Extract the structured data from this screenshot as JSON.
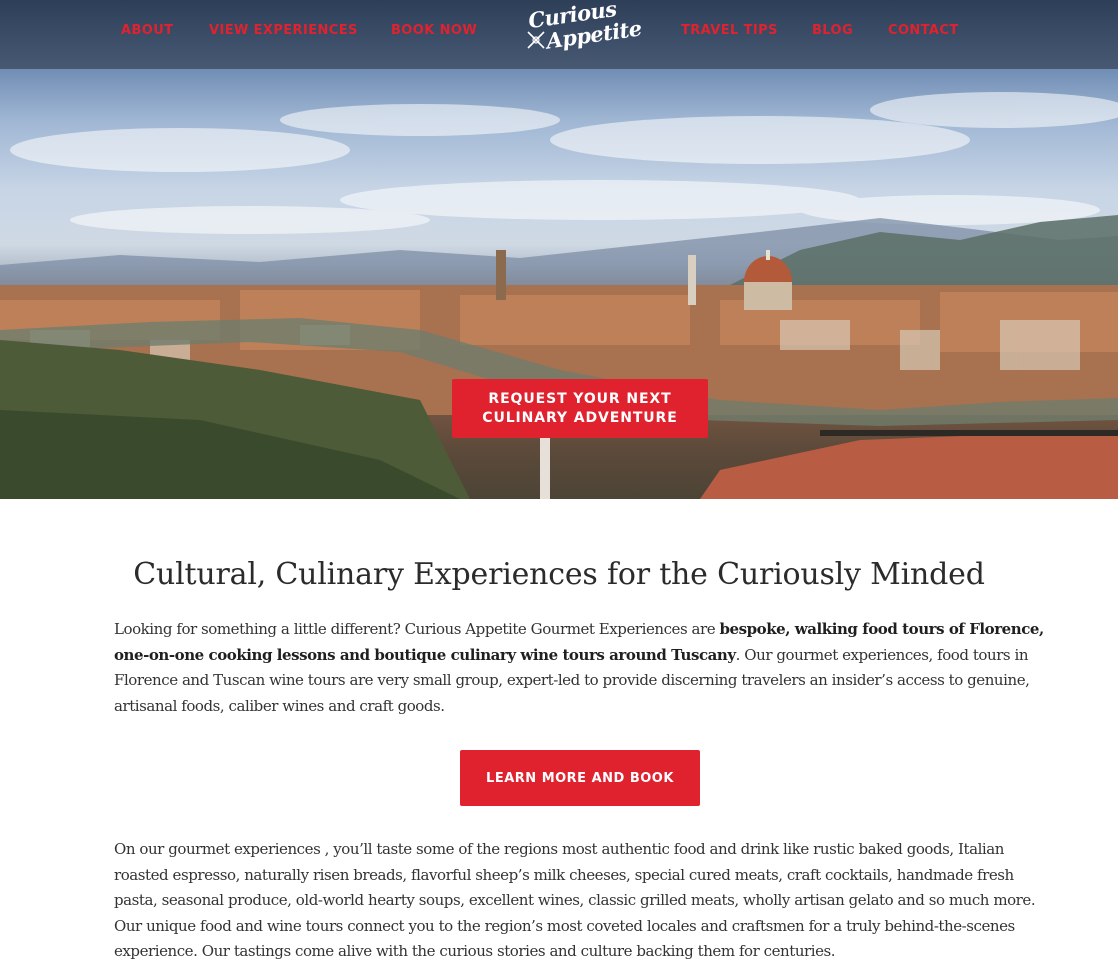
{
  "nav": {
    "items": [
      {
        "label": "ABOUT"
      },
      {
        "label": "VIEW EXPERIENCES"
      },
      {
        "label": "BOOK NOW"
      },
      {
        "label": "TRAVEL TIPS"
      },
      {
        "label": "BLOG"
      },
      {
        "label": "CONTACT"
      }
    ],
    "logo": {
      "line1": "Curious",
      "line2": "Appetite"
    }
  },
  "hero": {
    "image": "florence-cityscape-panorama",
    "cta_line1": "REQUEST YOUR NEXT",
    "cta_line2": "CULINARY ADVENTURE"
  },
  "intro": {
    "heading": "Cultural, Culinary Experiences for the Curiously Minded",
    "p1_before": "Looking for something a little different? Curious Appetite Gourmet Experiences are ",
    "p1_bold": "bespoke, walking food tours of Florence, one-on-one cooking lessons and boutique culinary wine tours around Tuscany",
    "p1_after": ". Our gourmet experiences, food tours in Florence and Tuscan wine tours are very small group, expert-led to provide discerning travelers an insider’s access to genuine, artisanal foods, caliber wines and craft goods.",
    "button_label": "LEARN MORE AND BOOK",
    "p2": "On our gourmet experiences , you’ll taste some of the regions most authentic food and drink like rustic baked goods, Italian roasted espresso, naturally risen breads, flavorful sheep’s milk cheeses, special cured meats, craft cocktails, handmade fresh pasta, seasonal produce, old-world hearty soups, excellent wines, classic grilled meats, wholly artisan gelato and so much more. Our unique food and wine tours connect you to the region’s most coveted locales and craftsmen for a truly behind-the-scenes experience. Our tastings come alive with the curious stories and culture backing them for centuries."
  },
  "colors": {
    "accent": "#e0222f",
    "text": "#333333",
    "heading": "#2b2b2b"
  }
}
